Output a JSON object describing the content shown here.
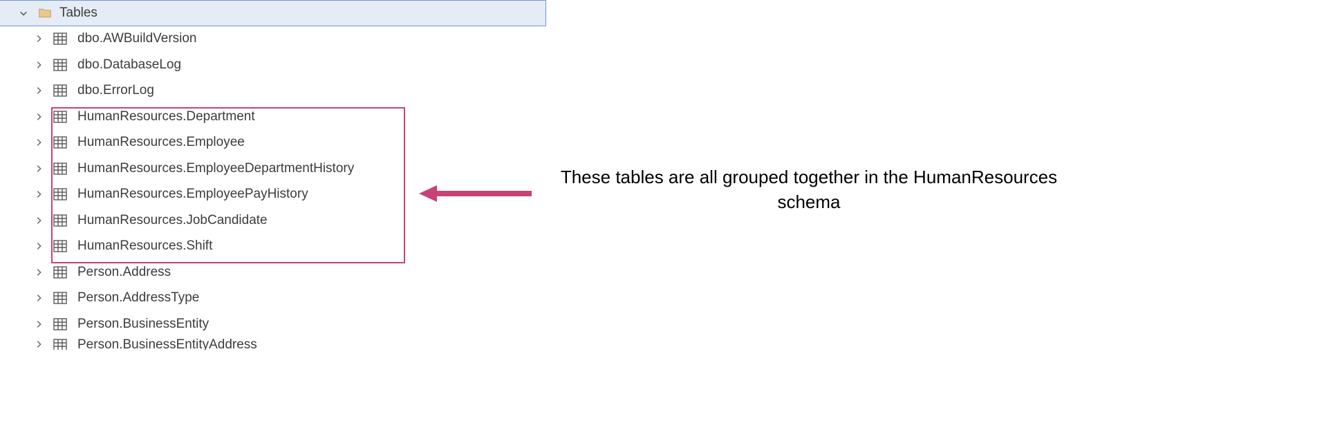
{
  "root": {
    "label": "Tables",
    "expanded": true
  },
  "tables": [
    {
      "name": "dbo.AWBuildVersion",
      "highlighted": false
    },
    {
      "name": "dbo.DatabaseLog",
      "highlighted": false
    },
    {
      "name": "dbo.ErrorLog",
      "highlighted": false
    },
    {
      "name": "HumanResources.Department",
      "highlighted": true
    },
    {
      "name": "HumanResources.Employee",
      "highlighted": true
    },
    {
      "name": "HumanResources.EmployeeDepartmentHistory",
      "highlighted": true
    },
    {
      "name": "HumanResources.EmployeePayHistory",
      "highlighted": true
    },
    {
      "name": "HumanResources.JobCandidate",
      "highlighted": true
    },
    {
      "name": "HumanResources.Shift",
      "highlighted": true
    },
    {
      "name": "Person.Address",
      "highlighted": false
    },
    {
      "name": "Person.AddressType",
      "highlighted": false
    },
    {
      "name": "Person.BusinessEntity",
      "highlighted": false
    },
    {
      "name": "Person.BusinessEntityAddress",
      "highlighted": false
    }
  ],
  "annotation": {
    "text": "These tables are all grouped together in the HumanResources schema"
  },
  "colors": {
    "highlight_border": "#c94277",
    "selection_bg": "#e6ecf5",
    "selection_border": "#6a99d8",
    "text": "#3c3c3c"
  }
}
